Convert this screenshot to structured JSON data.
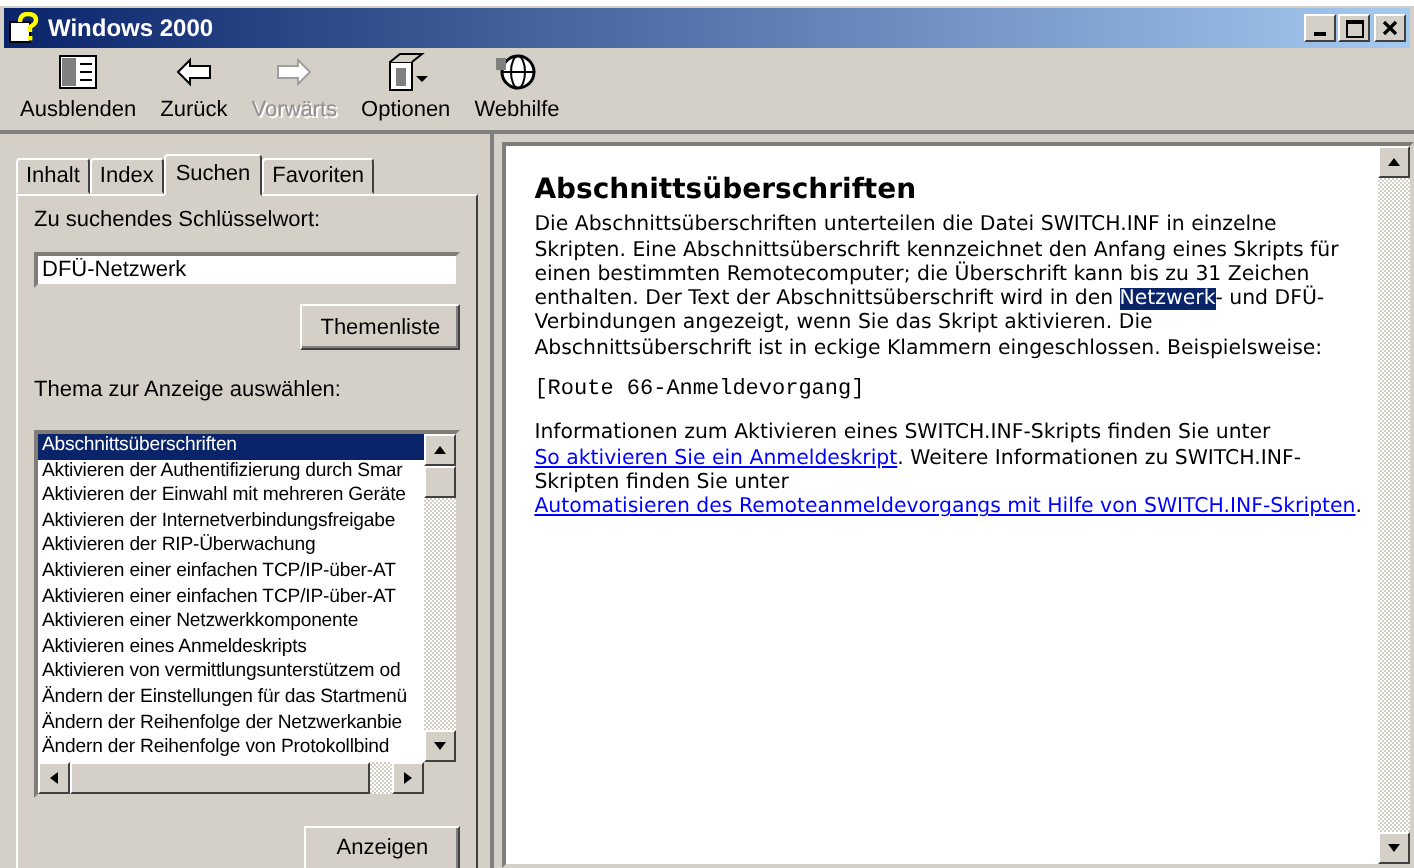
{
  "window": {
    "title": "Windows 2000"
  },
  "toolbar": [
    {
      "kind": "hide",
      "label": "Ausblenden",
      "disabled": false
    },
    {
      "kind": "back",
      "label": "Zurück",
      "disabled": false
    },
    {
      "kind": "forward",
      "label": "Vorwärts",
      "disabled": true
    },
    {
      "kind": "options",
      "label": "Optionen",
      "disabled": false
    },
    {
      "kind": "web",
      "label": "Webhilfe",
      "disabled": false
    }
  ],
  "tabs": [
    {
      "label": "Inhalt",
      "selected": false
    },
    {
      "label": "Index",
      "selected": false
    },
    {
      "label": "Suchen",
      "selected": true
    },
    {
      "label": "Favoriten",
      "selected": false
    }
  ],
  "search": {
    "label": "Zu suchendes Schlüsselwort:",
    "value": "DFÜ-Netzwerk",
    "button": "Themenliste"
  },
  "topics": {
    "label": "Thema zur Anzeige auswählen:",
    "items": [
      {
        "text": "Abschnittsüberschriften",
        "selected": true
      },
      {
        "text": "Aktivieren der Authentifizierung durch Smar",
        "selected": false
      },
      {
        "text": "Aktivieren der Einwahl mit mehreren Geräte",
        "selected": false
      },
      {
        "text": "Aktivieren der Internetverbindungsfreigabe",
        "selected": false
      },
      {
        "text": "Aktivieren der RIP-Überwachung",
        "selected": false
      },
      {
        "text": "Aktivieren einer einfachen TCP/IP-über-AT",
        "selected": false
      },
      {
        "text": "Aktivieren einer einfachen TCP/IP-über-AT",
        "selected": false
      },
      {
        "text": "Aktivieren einer Netzwerkkomponente",
        "selected": false
      },
      {
        "text": "Aktivieren eines Anmeldeskripts",
        "selected": false
      },
      {
        "text": "Aktivieren von vermittlungsunterstützem od",
        "selected": false
      },
      {
        "text": "Ändern der Einstellungen für das Startmenü",
        "selected": false
      },
      {
        "text": "Ändern der Reihenfolge der Netzwerkanbie",
        "selected": false
      },
      {
        "text": "Ändern der Reihenfolge von Protokollbind",
        "selected": false
      }
    ],
    "display_button": "Anzeigen"
  },
  "article": {
    "title": "Abschnittsüberschriften",
    "intro": [
      {
        "kind": "text",
        "text": "Die Abschnittsüberschriften unterteilen die Datei SWITCH.INF in einzelne Skripten. Eine Abschnittsüberschrift kennzeichnet den Anfang eines Skripts für einen bestimmten Remotecomputer; die Überschrift kann bis zu 31 Zeichen enthalten. Der Text der Abschnittsüberschrift wird in den "
      },
      {
        "kind": "highlight",
        "text": "Netzwerk"
      },
      {
        "kind": "text",
        "text": "- und DFÜ-Verbindungen angezeigt, wenn Sie das Skript aktivieren. Die Abschnittsüberschrift ist in eckige Klammern eingeschlossen. Beispielsweise:"
      }
    ],
    "example": "[Route 66-Anmeldevorgang]",
    "info": [
      {
        "kind": "text",
        "text": "Informationen zum Aktivieren eines SWITCH.INF-Skripts finden Sie unter "
      },
      {
        "kind": "link",
        "text": "So aktivieren Sie ein Anmeldeskript"
      },
      {
        "kind": "text",
        "text": ". Weitere Informationen zu SWITCH.INF-Skripten finden Sie unter "
      },
      {
        "kind": "link",
        "text": "Automatisieren des Remoteanmeldevorgangs mit Hilfe von SWITCH.INF-Skripten"
      },
      {
        "kind": "text",
        "text": "."
      }
    ]
  }
}
